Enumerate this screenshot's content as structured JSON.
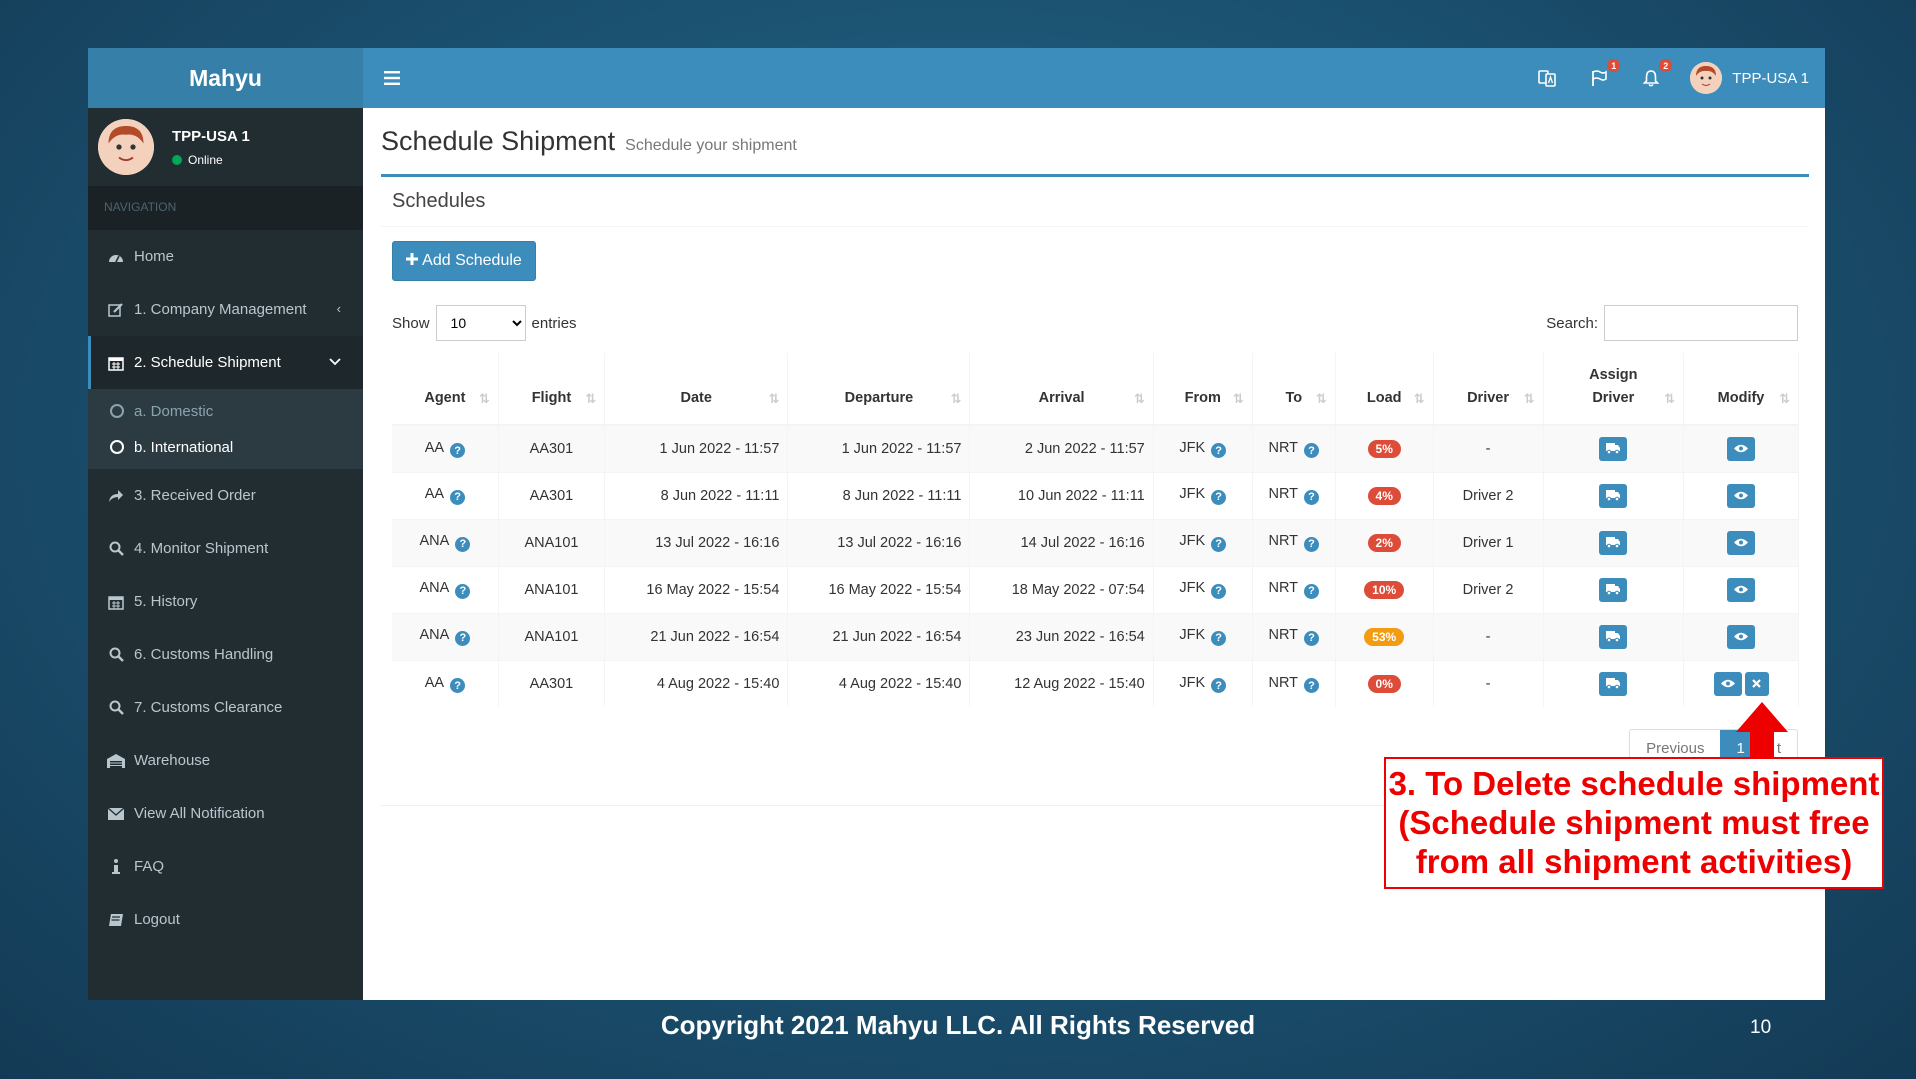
{
  "app": {
    "brand": "Mahyu"
  },
  "topbar": {
    "flag_badge": "1",
    "bell_badge": "2",
    "user": "TPP-USA 1"
  },
  "sidebar": {
    "user_name": "TPP-USA 1",
    "status": "Online",
    "nav_header": "NAVIGATION",
    "items": [
      {
        "label": "Home",
        "icon": "dashboard-icon"
      },
      {
        "label": "1. Company Management",
        "icon": "edit-icon"
      },
      {
        "label": "2. Schedule Shipment",
        "icon": "calendar-icon"
      },
      {
        "label": "3. Received Order",
        "icon": "share-icon"
      },
      {
        "label": "4. Monitor Shipment",
        "icon": "search-icon"
      },
      {
        "label": "5. History",
        "icon": "calendar-icon"
      },
      {
        "label": "6. Customs Handling",
        "icon": "search-icon"
      },
      {
        "label": "7. Customs Clearance",
        "icon": "search-icon"
      },
      {
        "label": "Warehouse",
        "icon": "warehouse-icon"
      },
      {
        "label": "View All Notification",
        "icon": "envelope-icon"
      },
      {
        "label": "FAQ",
        "icon": "info-icon"
      },
      {
        "label": "Logout",
        "icon": "book-icon"
      }
    ],
    "sub_items": [
      {
        "label": "a. Domestic"
      },
      {
        "label": "b. International"
      }
    ]
  },
  "page": {
    "title": "Schedule Shipment",
    "subtitle": "Schedule your shipment",
    "box_title": "Schedules",
    "add_button": "Add Schedule",
    "show_label": "Show",
    "entries_value": "10",
    "entries_label": "entries",
    "search_label": "Search:"
  },
  "table": {
    "headers": [
      "Agent",
      "Flight",
      "Date",
      "Departure",
      "Arrival",
      "From",
      "To",
      "Load",
      "Driver",
      "Assign Driver",
      "Modify"
    ],
    "rows": [
      {
        "agent": "AA",
        "flight": "AA301",
        "date": "1 Jun 2022 - 11:57",
        "departure": "1 Jun 2022 - 11:57",
        "arrival": "2 Jun 2022 - 11:57",
        "from": "JFK",
        "to": "NRT",
        "load": "5%",
        "driver": "-"
      },
      {
        "agent": "AA",
        "flight": "AA301",
        "date": "8 Jun 2022 - 11:11",
        "departure": "8 Jun 2022 - 11:11",
        "arrival": "10 Jun 2022 - 11:11",
        "from": "JFK",
        "to": "NRT",
        "load": "4%",
        "driver": "Driver 2"
      },
      {
        "agent": "ANA",
        "flight": "ANA101",
        "date": "13 Jul 2022 - 16:16",
        "departure": "13 Jul 2022 - 16:16",
        "arrival": "14 Jul 2022 - 16:16",
        "from": "JFK",
        "to": "NRT",
        "load": "2%",
        "driver": "Driver 1"
      },
      {
        "agent": "ANA",
        "flight": "ANA101",
        "date": "16 May 2022 - 15:54",
        "departure": "16 May 2022 - 15:54",
        "arrival": "18 May 2022 - 07:54",
        "from": "JFK",
        "to": "NRT",
        "load": "10%",
        "driver": "Driver 2"
      },
      {
        "agent": "ANA",
        "flight": "ANA101",
        "date": "21 Jun 2022 - 16:54",
        "departure": "21 Jun 2022 - 16:54",
        "arrival": "23 Jun 2022 - 16:54",
        "from": "JFK",
        "to": "NRT",
        "load": "53%",
        "driver": "-"
      },
      {
        "agent": "AA",
        "flight": "AA301",
        "date": "4 Aug 2022 - 15:40",
        "departure": "4 Aug 2022 - 15:40",
        "arrival": "12 Aug 2022 - 15:40",
        "from": "JFK",
        "to": "NRT",
        "load": "0%",
        "driver": "-"
      }
    ]
  },
  "pager": {
    "previous": "Previous",
    "current": "1",
    "next": "t"
  },
  "annotation": {
    "line1": "3. To Delete schedule shipment",
    "line2": "(Schedule shipment must free",
    "line3": "from all shipment activities)"
  },
  "footer": {
    "copyright": "Copyright 2021 Mahyu LLC. All Rights Reserved",
    "page_number": "10"
  },
  "colors": {
    "primary": "#3c8dbc",
    "sidebar": "#222d32",
    "danger": "#dd4b39",
    "warning": "#f39c12",
    "annotation": "#ee0000"
  }
}
